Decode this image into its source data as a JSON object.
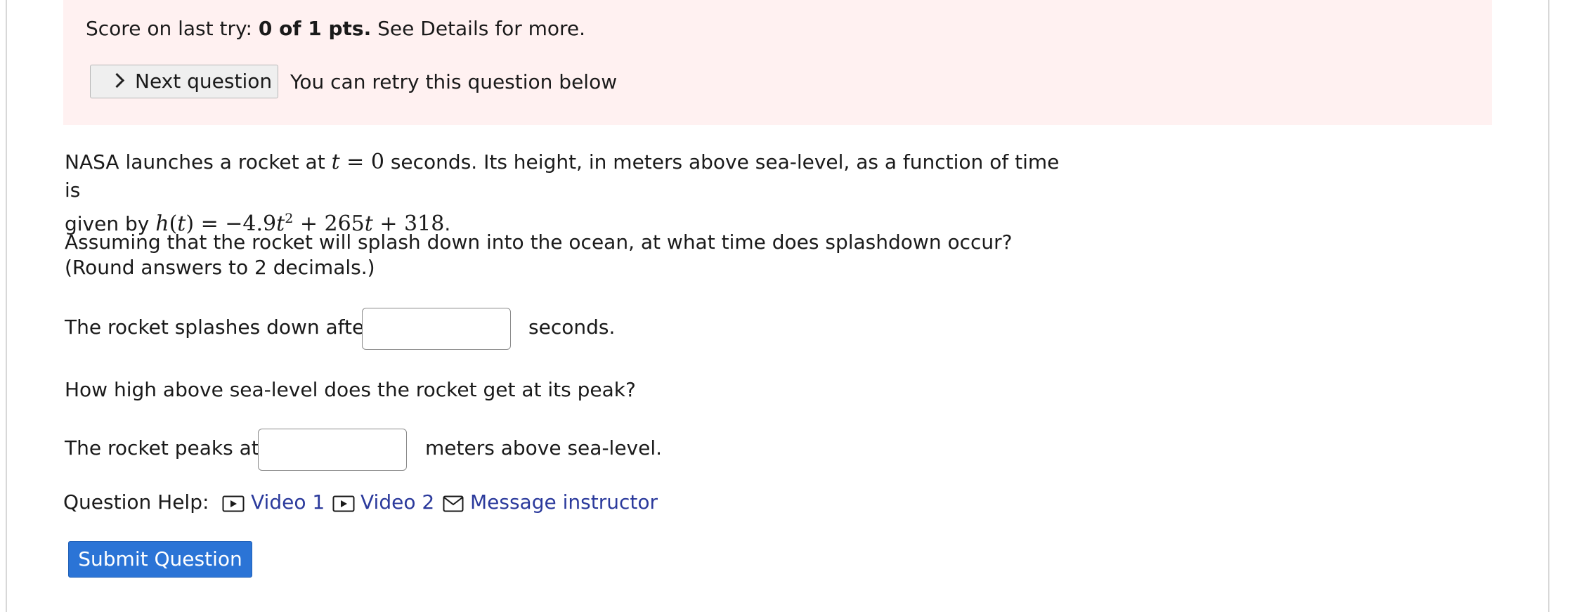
{
  "score": {
    "prefix": "Score on last try: ",
    "points": "0 of 1 pts.",
    "suffix": " See Details for more."
  },
  "next_button_label": "Next question",
  "retry_text": "You can retry this question below",
  "problem": {
    "line1_a": "NASA launches a rocket at ",
    "line1_b": " seconds. Its height, in meters above sea-level, as a function of time is",
    "line2_a": "given by ",
    "line2_b": ".",
    "math_t0": "t = 0",
    "math_h": "h(t) = −4.9t² + 265t + 318",
    "question1": "Assuming that the rocket will splash down into the ocean, at what time does splashdown occur? (Round answers to 2 decimals.)",
    "question2": "How high above sea-level does the rocket get at its peak?"
  },
  "answer1": {
    "label_before": "The rocket splashes down after",
    "label_after": "seconds.",
    "value": ""
  },
  "answer2": {
    "label_before": "The rocket peaks at",
    "label_after": "meters above sea-level.",
    "value": ""
  },
  "help": {
    "label": "Question Help:",
    "video1": "Video 1",
    "video2": "Video 2",
    "message": "Message instructor",
    "icons": [
      "video-icon",
      "video-icon",
      "mail-icon"
    ]
  },
  "submit_label": "Submit Question",
  "colors": {
    "score_box_bg": "#fff1f1",
    "link": "#2b3a9c",
    "submit_bg": "#2b74d6"
  }
}
